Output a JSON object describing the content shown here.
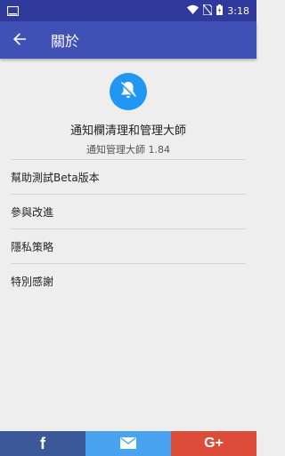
{
  "status_bar": {
    "time": "3:18",
    "icons": [
      "screen-icon",
      "wifi-icon",
      "no-sim-icon",
      "battery-icon"
    ]
  },
  "app_bar": {
    "title": "關於",
    "back_icon": "arrow-back-icon",
    "color": "#3f51b5"
  },
  "header": {
    "logo_icon": "notification-off-icon",
    "app_name": "通知欄清理和管理大師",
    "version": "通知管理大師 1.84"
  },
  "menu": {
    "items": [
      {
        "label": "幫助測試Beta版本"
      },
      {
        "label": "參與改進"
      },
      {
        "label": "隱私策略"
      },
      {
        "label": "特別感謝"
      }
    ]
  },
  "share_bar": {
    "facebook_label": "f",
    "email_icon": "email-icon",
    "gplus_label": "G+",
    "colors": {
      "facebook": "#3b5998",
      "email": "#4aa3f0",
      "gplus": "#dd4b39"
    }
  }
}
